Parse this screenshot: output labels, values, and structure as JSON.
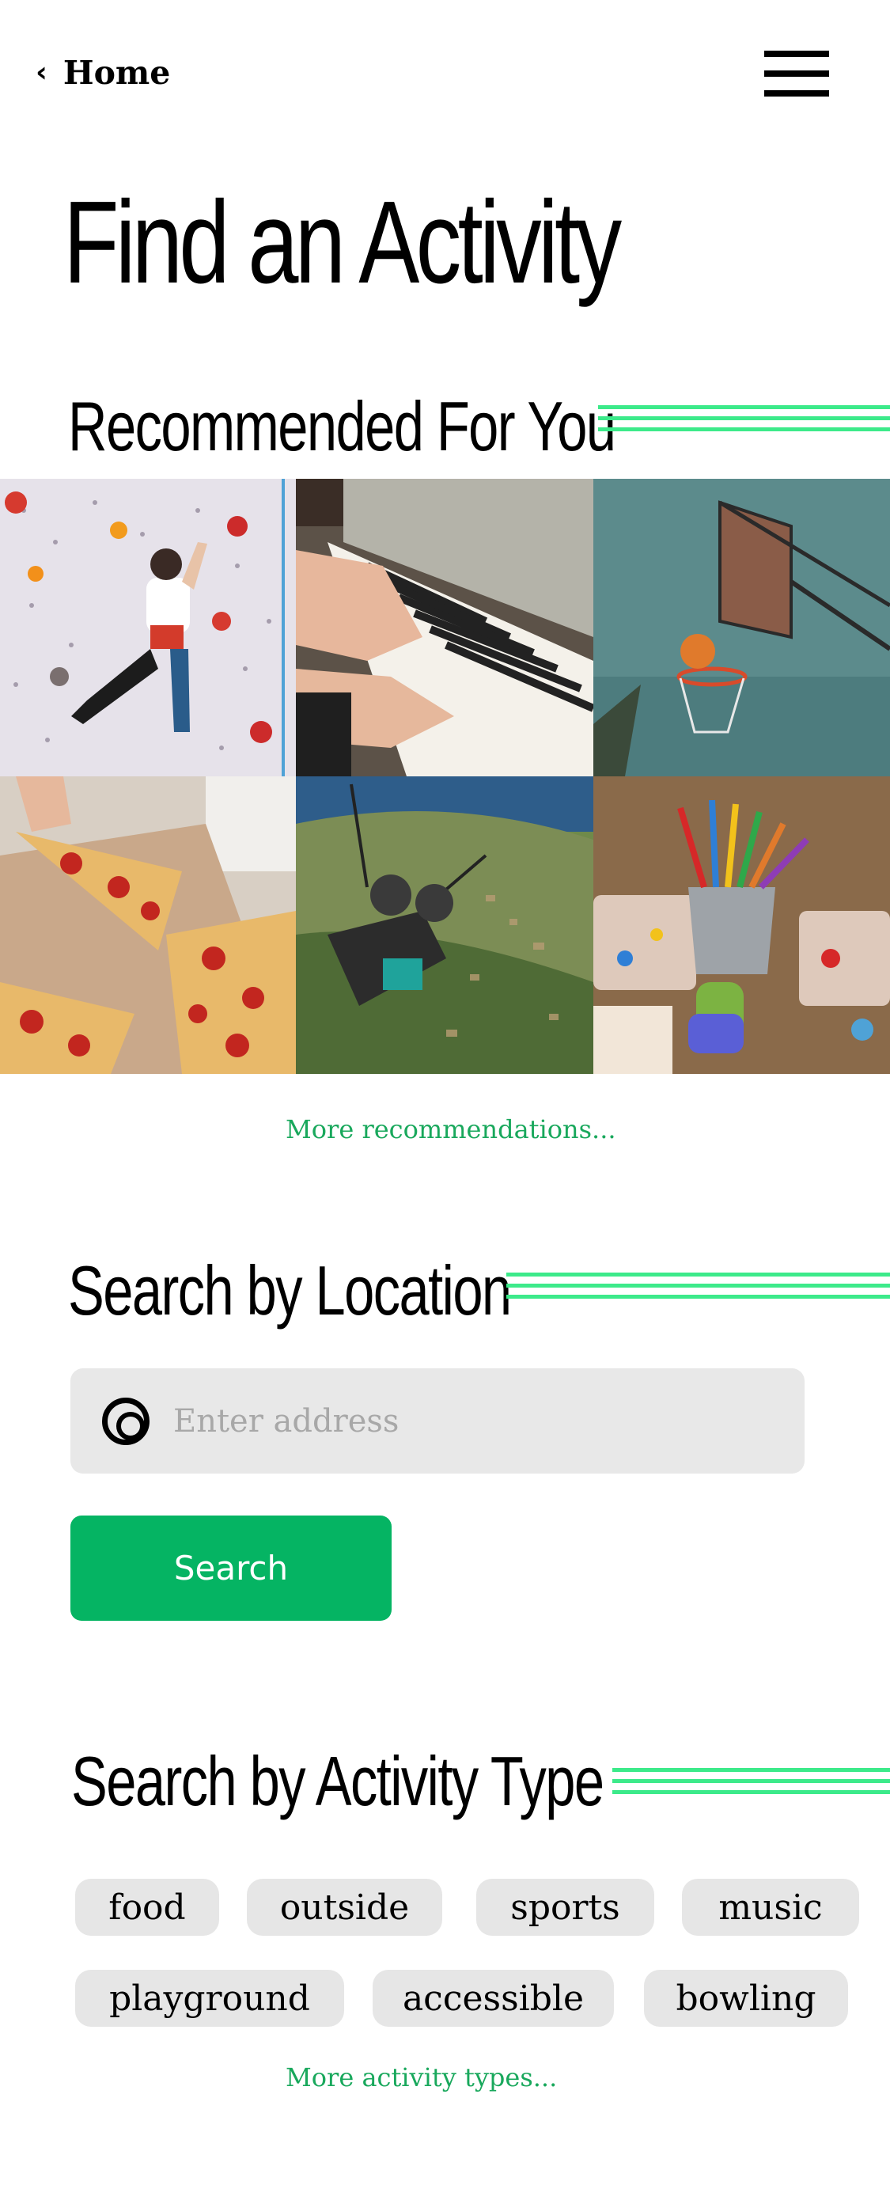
{
  "header": {
    "back_label": "Home"
  },
  "page_title": "Find an Activity",
  "recommended": {
    "heading": "Recommended For You",
    "more_link": "More recommendations..."
  },
  "location": {
    "heading": "Search by Location",
    "address_placeholder": "Enter address",
    "search_button": "Search"
  },
  "activity_type": {
    "heading": "Search by Activity Type",
    "chips": [
      "food",
      "outside",
      "sports",
      "music",
      "playground",
      "accessible",
      "bowling"
    ],
    "more_link": "More activity types..."
  },
  "colors": {
    "accent": "#05b463",
    "link": "#19a85c",
    "stripe": "#3cea8a"
  }
}
